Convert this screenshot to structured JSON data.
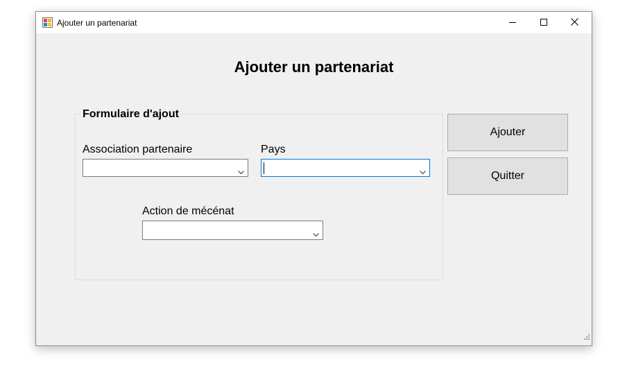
{
  "window": {
    "title": "Ajouter un partenariat",
    "app_icon": "form-app-icon",
    "controls": [
      "minimize-icon",
      "maximize-icon",
      "close-icon"
    ]
  },
  "main": {
    "heading": "Ajouter un partenariat"
  },
  "form": {
    "group_title": "Formulaire d'ajout",
    "association_label": "Association partenaire",
    "association_value": "",
    "pays_label": "Pays",
    "pays_value": "",
    "action_label": "Action de mécénat",
    "action_value": ""
  },
  "buttons": {
    "add_label": "Ajouter",
    "quit_label": "Quitter"
  },
  "colors": {
    "window_bg": "#f0f0f0",
    "focus_border": "#0078d7",
    "button_bg": "#e1e1e1"
  }
}
